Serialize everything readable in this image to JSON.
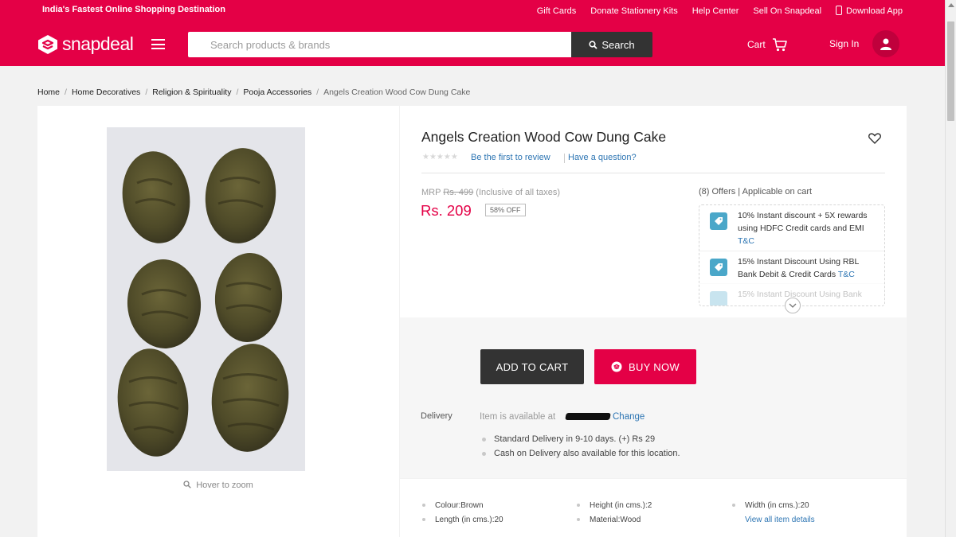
{
  "topbar": {
    "tagline": "India's Fastest Online Shopping Destination",
    "links": [
      "Gift Cards",
      "Donate Stationery Kits",
      "Help Center",
      "Sell On Snapdeal"
    ],
    "download_app": "Download App"
  },
  "header": {
    "logo_text": "snapdeal",
    "search_placeholder": "Search products & brands",
    "search_button": "Search",
    "cart_label": "Cart",
    "signin_label": "Sign In"
  },
  "breadcrumb": {
    "items": [
      "Home",
      "Home Decoratives",
      "Religion & Spirituality",
      "Pooja Accessories"
    ],
    "current": "Angels Creation Wood Cow Dung Cake"
  },
  "gallery": {
    "zoom_hint": "Hover to zoom"
  },
  "product": {
    "title": "Angels Creation Wood Cow Dung Cake",
    "review_link": "Be the first to review",
    "question_link": "Have a question?",
    "mrp_label": "MRP",
    "mrp_value": "Rs. 499",
    "tax_note": "(Inclusive of all taxes)",
    "price": "Rs. 209",
    "discount": "58% OFF"
  },
  "offers": {
    "heading": "(8) Offers | Applicable on cart",
    "items": [
      {
        "text": "10% Instant discount + 5X rewards using HDFC Credit cards and EMI",
        "tc": "T&C"
      },
      {
        "text": "15% Instant Discount Using RBL Bank Debit & Credit Cards",
        "tc": "T&C"
      },
      {
        "text": "15% Instant Discount Using Bank",
        "tc": ""
      }
    ]
  },
  "actions": {
    "add_to_cart": "ADD TO CART",
    "buy_now": "BUY NOW"
  },
  "delivery": {
    "label": "Delivery",
    "availability": "Item is available at",
    "change": "Change",
    "points": [
      "Standard Delivery in 9-10 days. (+) Rs 29",
      "Cash on Delivery also available for this location."
    ]
  },
  "specs": {
    "items": [
      "Colour:Brown",
      "Height (in cms.):2",
      "Width (in cms.):20",
      "Length (in cms.):20",
      "Material:Wood"
    ],
    "view_all": "View all item details"
  },
  "colors": {
    "brand": "#e40046",
    "link": "#2d75b3",
    "dark_button": "#333333",
    "offer_icon": "#4aa7c9"
  }
}
